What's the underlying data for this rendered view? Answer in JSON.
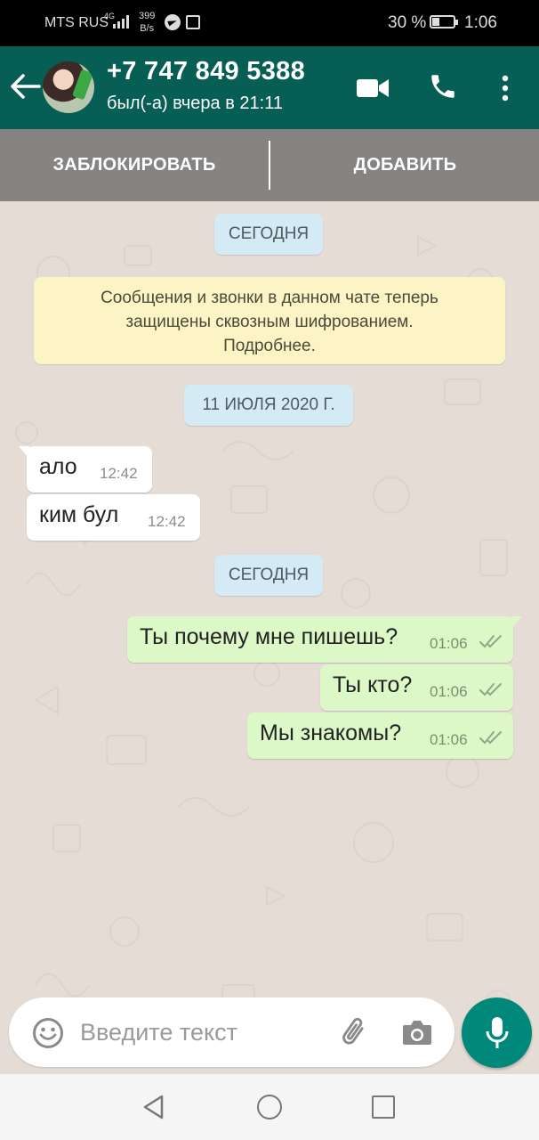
{
  "status_bar": {
    "carrier": "MTS RUS",
    "network": "4G",
    "speed_value": "399",
    "speed_unit": "B/s",
    "battery": "30 %",
    "time": "1:06"
  },
  "header": {
    "contact_name": "+7 747 849 5388",
    "last_seen": "был(-а) вчера в 21:11",
    "icons": [
      "back-arrow-icon",
      "avatar",
      "video-call-icon",
      "phone-icon",
      "more-vert-icon"
    ],
    "accent_color": "#075e54"
  },
  "action_bar": {
    "block_label": "ЗАБЛОКИРОВАТЬ",
    "add_label": "ДОБАВИТЬ"
  },
  "chat": {
    "date_today_1": "СЕГОДНЯ",
    "encryption_notice": {
      "line1": "Сообщения и звонки в данном чате теперь",
      "line2": "защищены сквозным шифрованием.",
      "line3": "Подробнее."
    },
    "date_july": "11 ИЮЛЯ 2020 Г.",
    "date_today_2": "СЕГОДНЯ",
    "messages": [
      {
        "direction": "in",
        "text": "ало",
        "time": "12:42"
      },
      {
        "direction": "in",
        "text": "ким бул",
        "time": "12:42"
      },
      {
        "direction": "out",
        "text": "Ты почему мне пишешь?",
        "time": "01:06",
        "status": "delivered"
      },
      {
        "direction": "out",
        "text": "Ты кто?",
        "time": "01:06",
        "status": "delivered"
      },
      {
        "direction": "out",
        "text": "Мы знакомы?",
        "time": "01:06",
        "status": "delivered"
      }
    ],
    "outgoing_color": "#dcf8c6",
    "incoming_color": "#ffffff"
  },
  "composer": {
    "placeholder": "Введите текст",
    "value": "",
    "icons": [
      "emoji-icon",
      "attach-icon",
      "camera-icon",
      "mic-icon"
    ],
    "mic_color": "#00897b"
  },
  "nav_bar": {
    "icons": [
      "nav-back-icon",
      "nav-home-icon",
      "nav-recent-icon"
    ]
  }
}
